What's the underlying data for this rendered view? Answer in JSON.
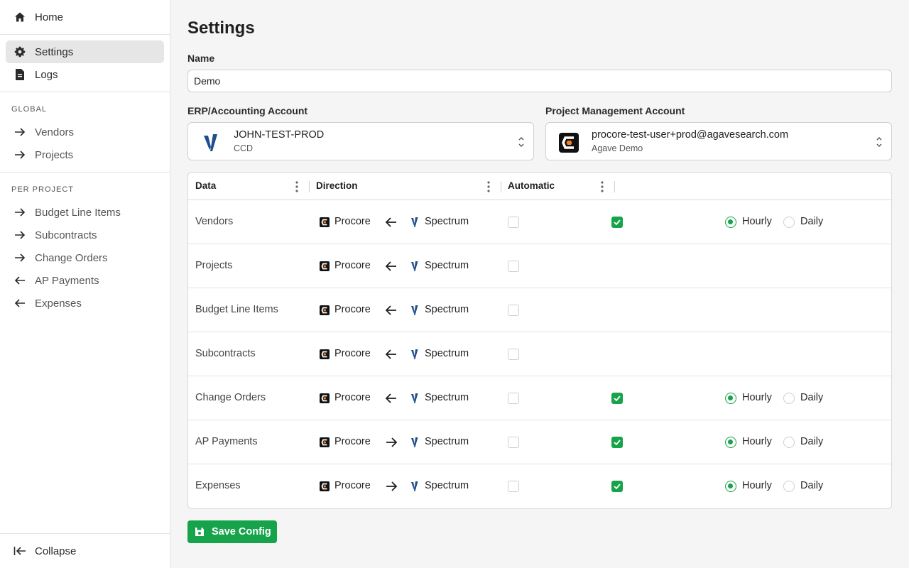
{
  "sidebar": {
    "top_items": [
      {
        "label": "Home",
        "icon": "home-icon"
      },
      {
        "label": "Settings",
        "icon": "gear-icon",
        "active": true
      },
      {
        "label": "Logs",
        "icon": "document-icon"
      }
    ],
    "global_section": "GLOBAL",
    "global_items": [
      {
        "label": "Vendors",
        "icon": "arrow-right-icon"
      },
      {
        "label": "Projects",
        "icon": "arrow-right-icon"
      }
    ],
    "per_project_section": "PER PROJECT",
    "per_project_items": [
      {
        "label": "Budget Line Items",
        "icon": "arrow-right-icon"
      },
      {
        "label": "Subcontracts",
        "icon": "arrow-right-icon"
      },
      {
        "label": "Change Orders",
        "icon": "arrow-right-icon"
      },
      {
        "label": "AP Payments",
        "icon": "arrow-left-icon"
      },
      {
        "label": "Expenses",
        "icon": "arrow-left-icon"
      }
    ],
    "collapse_label": "Collapse"
  },
  "page": {
    "title": "Settings",
    "name_label": "Name",
    "name_value": "Demo",
    "erp_label": "ERP/Accounting Account",
    "erp_account": {
      "title": "JOHN-TEST-PROD",
      "subtitle": "CCD"
    },
    "pm_label": "Project Management Account",
    "pm_account": {
      "title": "procore-test-user+prod@agavesearch.com",
      "subtitle": "Agave Demo"
    }
  },
  "table": {
    "headers": {
      "data": "Data",
      "direction": "Direction",
      "automatic": "Automatic"
    },
    "source_name": "Procore",
    "target_name": "Spectrum",
    "rows": [
      {
        "name": "Vendors",
        "direction": "left",
        "enabled": true,
        "frequency": "Hourly"
      },
      {
        "name": "Projects",
        "direction": "left",
        "enabled": false
      },
      {
        "name": "Budget Line Items",
        "direction": "left",
        "enabled": false
      },
      {
        "name": "Subcontracts",
        "direction": "left",
        "enabled": false
      },
      {
        "name": "Change Orders",
        "direction": "left",
        "enabled": true,
        "frequency": "Hourly"
      },
      {
        "name": "AP Payments",
        "direction": "right",
        "enabled": true,
        "frequency": "Hourly"
      },
      {
        "name": "Expenses",
        "direction": "right",
        "enabled": true,
        "frequency": "Hourly"
      }
    ],
    "radio_options": [
      "Hourly",
      "Daily"
    ]
  },
  "save_button": "Save Config",
  "colors": {
    "accent": "#16a34a",
    "spectrum_blue": "#1f4e8c",
    "procore_orange": "#f47e20"
  }
}
